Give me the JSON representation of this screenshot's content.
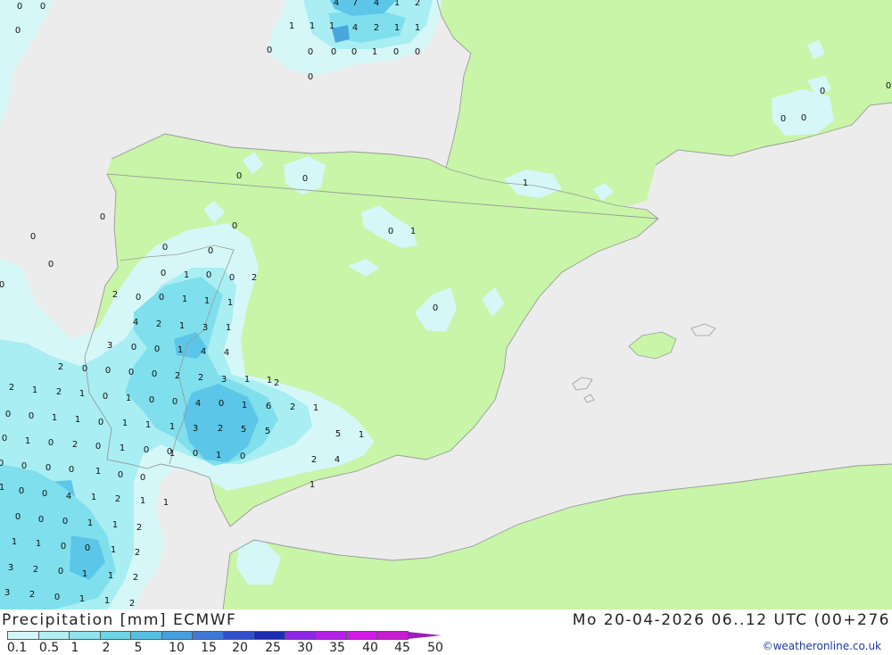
{
  "header": {
    "title": "Precipitation [mm] ECMWF",
    "datetime": "Mo 20-04-2026 06..12 UTC (00+276"
  },
  "legend": {
    "labels": [
      "0.1",
      "0.5",
      "1",
      "2",
      "5",
      "10",
      "15",
      "20",
      "25",
      "30",
      "35",
      "40",
      "45",
      "50"
    ],
    "colors": [
      "#d4f6f8",
      "#b3eef3",
      "#8fe3ec",
      "#6dd4e6",
      "#55bfe2",
      "#479fdd",
      "#3f78d6",
      "#2f4fc8",
      "#1d2cb4",
      "#8d27e6",
      "#b420e8",
      "#d21ae8",
      "#c71ccf",
      "#9c1fb8"
    ]
  },
  "credit": "©weatheronline.co.uk",
  "map": {
    "colors": {
      "sea": "#ececec",
      "land": "#c8f5a8",
      "border": "#9a9a9a",
      "precip_light": "#d6f7f8",
      "precip_mid": "#a8eef3",
      "precip_high": "#7fdfec",
      "precip_heavy": "#5bc6e8",
      "precip_max": "#4aa6de"
    },
    "value_labels": [
      {
        "t": "0"
      },
      {
        "t": "0"
      },
      {
        "t": "0"
      },
      {
        "t": "4"
      },
      {
        "t": "7"
      },
      {
        "t": "4"
      },
      {
        "t": "1"
      },
      {
        "t": "2"
      },
      {
        "t": "1"
      },
      {
        "t": "1"
      },
      {
        "t": "1"
      },
      {
        "t": "4"
      },
      {
        "t": "2"
      },
      {
        "t": "1"
      },
      {
        "t": "1"
      },
      {
        "t": "0"
      },
      {
        "t": "0"
      },
      {
        "t": "0"
      },
      {
        "t": "0"
      },
      {
        "t": "1"
      },
      {
        "t": "0"
      },
      {
        "t": "0"
      },
      {
        "t": "0"
      },
      {
        "t": "0"
      },
      {
        "t": "0"
      },
      {
        "t": "0"
      },
      {
        "t": "0"
      },
      {
        "t": "0"
      },
      {
        "t": "0"
      },
      {
        "t": "1"
      },
      {
        "t": "0"
      },
      {
        "t": "1"
      },
      {
        "t": "0"
      },
      {
        "t": "0"
      },
      {
        "t": "0"
      },
      {
        "t": "0"
      },
      {
        "t": "0"
      },
      {
        "t": "0"
      },
      {
        "t": "0"
      },
      {
        "t": "0"
      },
      {
        "t": "0"
      },
      {
        "t": "1"
      },
      {
        "t": "0"
      },
      {
        "t": "0"
      },
      {
        "t": "2"
      },
      {
        "t": "2"
      },
      {
        "t": "0"
      },
      {
        "t": "0"
      },
      {
        "t": "1"
      },
      {
        "t": "1"
      },
      {
        "t": "1"
      },
      {
        "t": "4"
      },
      {
        "t": "2"
      },
      {
        "t": "1"
      },
      {
        "t": "3"
      },
      {
        "t": "1"
      },
      {
        "t": "3"
      },
      {
        "t": "0"
      },
      {
        "t": "0"
      },
      {
        "t": "1"
      },
      {
        "t": "4"
      },
      {
        "t": "4"
      },
      {
        "t": "2"
      },
      {
        "t": "0"
      },
      {
        "t": "0"
      },
      {
        "t": "0"
      },
      {
        "t": "0"
      },
      {
        "t": "2"
      },
      {
        "t": "2"
      },
      {
        "t": "3"
      },
      {
        "t": "1"
      },
      {
        "t": "1"
      },
      {
        "t": "2"
      },
      {
        "t": "1"
      },
      {
        "t": "2"
      },
      {
        "t": "1"
      },
      {
        "t": "0"
      },
      {
        "t": "1"
      },
      {
        "t": "0"
      },
      {
        "t": "0"
      },
      {
        "t": "4"
      },
      {
        "t": "0"
      },
      {
        "t": "1"
      },
      {
        "t": "6"
      },
      {
        "t": "2"
      },
      {
        "t": "1"
      },
      {
        "t": "0"
      },
      {
        "t": "0"
      },
      {
        "t": "1"
      },
      {
        "t": "1"
      },
      {
        "t": "0"
      },
      {
        "t": "1"
      },
      {
        "t": "1"
      },
      {
        "t": "1"
      },
      {
        "t": "0"
      },
      {
        "t": "1"
      },
      {
        "t": "0"
      },
      {
        "t": "2"
      },
      {
        "t": "0"
      },
      {
        "t": "1"
      },
      {
        "t": "0"
      },
      {
        "t": "0"
      },
      {
        "t": "3"
      },
      {
        "t": "2"
      },
      {
        "t": "5"
      },
      {
        "t": "5"
      },
      {
        "t": "5"
      },
      {
        "t": "1"
      },
      {
        "t": "0"
      },
      {
        "t": "0"
      },
      {
        "t": "0"
      },
      {
        "t": "0"
      },
      {
        "t": "1"
      },
      {
        "t": "0"
      },
      {
        "t": "1"
      },
      {
        "t": "0"
      },
      {
        "t": "2"
      },
      {
        "t": "2"
      },
      {
        "t": "4"
      },
      {
        "t": "1"
      },
      {
        "t": "1"
      },
      {
        "t": "0"
      },
      {
        "t": "0"
      },
      {
        "t": "1"
      },
      {
        "t": "0"
      },
      {
        "t": "0"
      },
      {
        "t": "4"
      },
      {
        "t": "1"
      },
      {
        "t": "2"
      },
      {
        "t": "1"
      },
      {
        "t": "1"
      },
      {
        "t": "0"
      },
      {
        "t": "0"
      },
      {
        "t": "0"
      },
      {
        "t": "1"
      },
      {
        "t": "1"
      },
      {
        "t": "2"
      },
      {
        "t": "1"
      },
      {
        "t": "1"
      },
      {
        "t": "0"
      },
      {
        "t": "0"
      },
      {
        "t": "1"
      },
      {
        "t": "2"
      },
      {
        "t": "3"
      },
      {
        "t": "2"
      },
      {
        "t": "0"
      },
      {
        "t": "1"
      },
      {
        "t": "1"
      },
      {
        "t": "2"
      },
      {
        "t": "3"
      },
      {
        "t": "2"
      },
      {
        "t": "0"
      },
      {
        "t": "1"
      },
      {
        "t": "1"
      },
      {
        "t": "2"
      },
      {
        "t": "2"
      },
      {
        "t": "1"
      },
      {
        "t": "0"
      }
    ]
  }
}
